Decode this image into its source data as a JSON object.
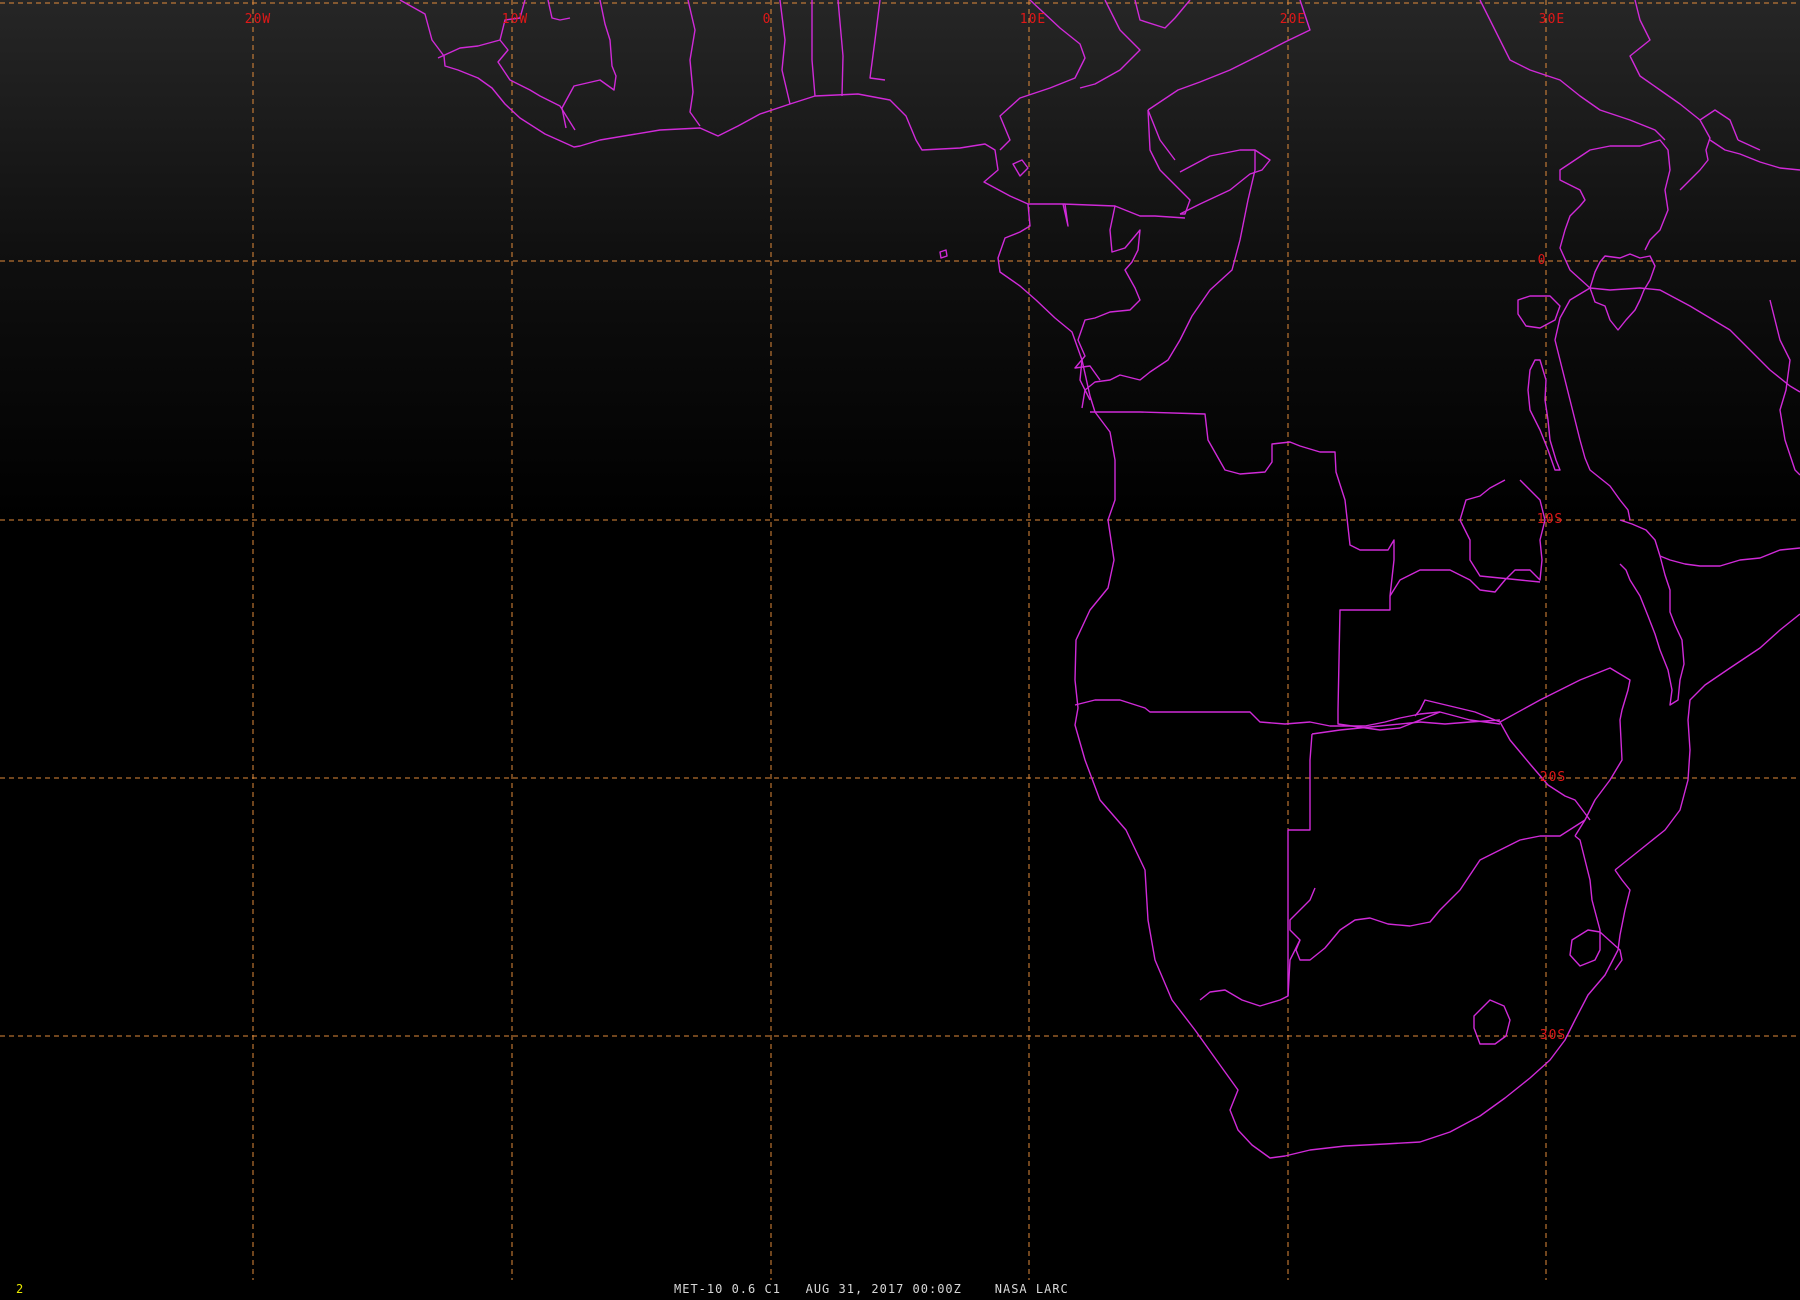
{
  "viewer": {
    "frame_number": "2",
    "product_line": "MET-10 0.6 C1   AUG 31, 2017 00:00Z    NASA LARC"
  },
  "colors": {
    "background": "#000000",
    "grid_lines": "#e08a3a",
    "grid_labels": "#e01818",
    "boundaries": "#d02ad8",
    "frame_number": "#e8e800",
    "status_text": "#d8d8d8"
  },
  "grid": {
    "longitude_labels": [
      "20W",
      "10W",
      "0",
      "10E",
      "20E",
      "30E"
    ],
    "latitude_labels": [
      "0",
      "10S",
      "20S",
      "30S"
    ]
  }
}
